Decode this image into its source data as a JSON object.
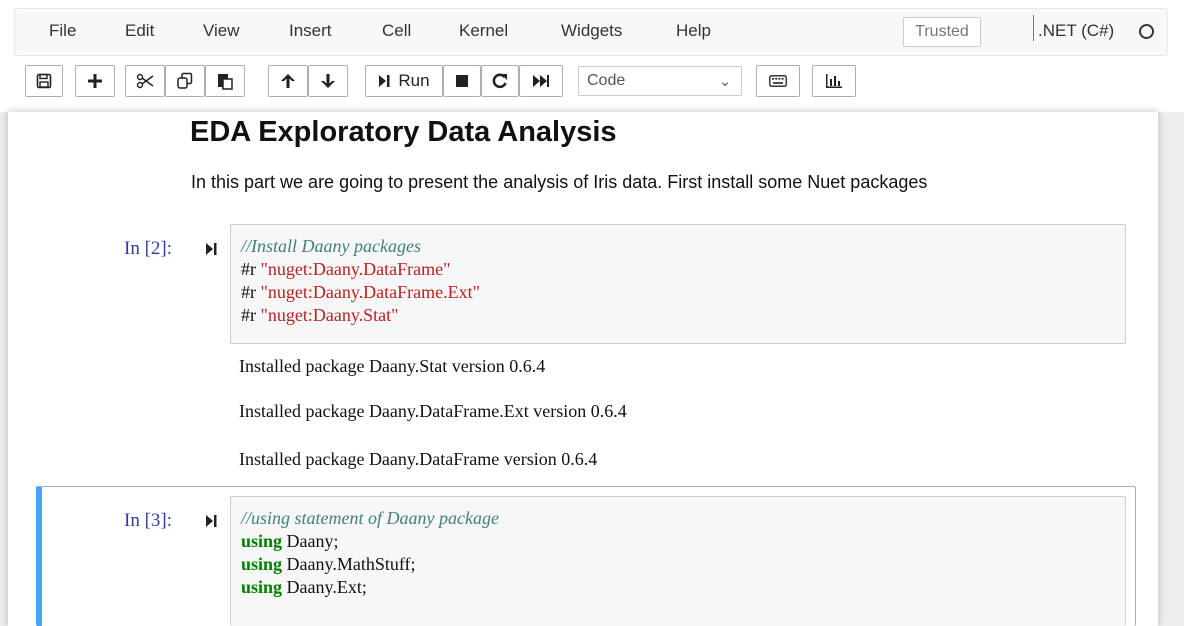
{
  "menu": {
    "items": [
      "File",
      "Edit",
      "View",
      "Insert",
      "Cell",
      "Kernel",
      "Widgets",
      "Help"
    ],
    "trusted": "Trusted",
    "kernel_name": ".NET (C#)"
  },
  "toolbar": {
    "run_label": "Run",
    "cell_type": "Code",
    "icons": [
      "save-icon",
      "plus-icon",
      "cut-icon",
      "copy-icon",
      "paste-icon",
      "arrow-up-icon",
      "arrow-down-icon",
      "run-icon",
      "stop-icon",
      "restart-icon",
      "fast-forward-icon",
      "keyboard-icon",
      "chart-icon"
    ]
  },
  "notebook": {
    "heading": "EDA Exploratory Data Analysis",
    "intro": "In this part we are going to present the analysis of Iris data. First install some Nuet packages",
    "cells": [
      {
        "prompt": "In [2]:",
        "comment": "//Install Daany packages",
        "lines": [
          {
            "prefix": "#r ",
            "string": "\"nuget:Daany.DataFrame\""
          },
          {
            "prefix": "#r ",
            "string": "\"nuget:Daany.DataFrame.Ext\""
          },
          {
            "prefix": "#r ",
            "string": "\"nuget:Daany.Stat\""
          }
        ],
        "outputs": [
          "Installed package Daany.Stat version 0.6.4",
          "Installed package Daany.DataFrame.Ext version 0.6.4",
          "Installed package Daany.DataFrame version 0.6.4"
        ]
      },
      {
        "prompt": "In [3]:",
        "comment": "//using statement of Daany package",
        "lines": [
          {
            "keyword": "using",
            "rest": " Daany;"
          },
          {
            "keyword": "using",
            "rest": " Daany.MathStuff;"
          },
          {
            "keyword": "using",
            "rest": " Daany.Ext;"
          }
        ]
      }
    ]
  },
  "colors": {
    "prompt": "#303f9f",
    "comment": "#408080",
    "string": "#ba2121",
    "keyword": "#008000",
    "selected_cell_border": "#42a5f5"
  }
}
